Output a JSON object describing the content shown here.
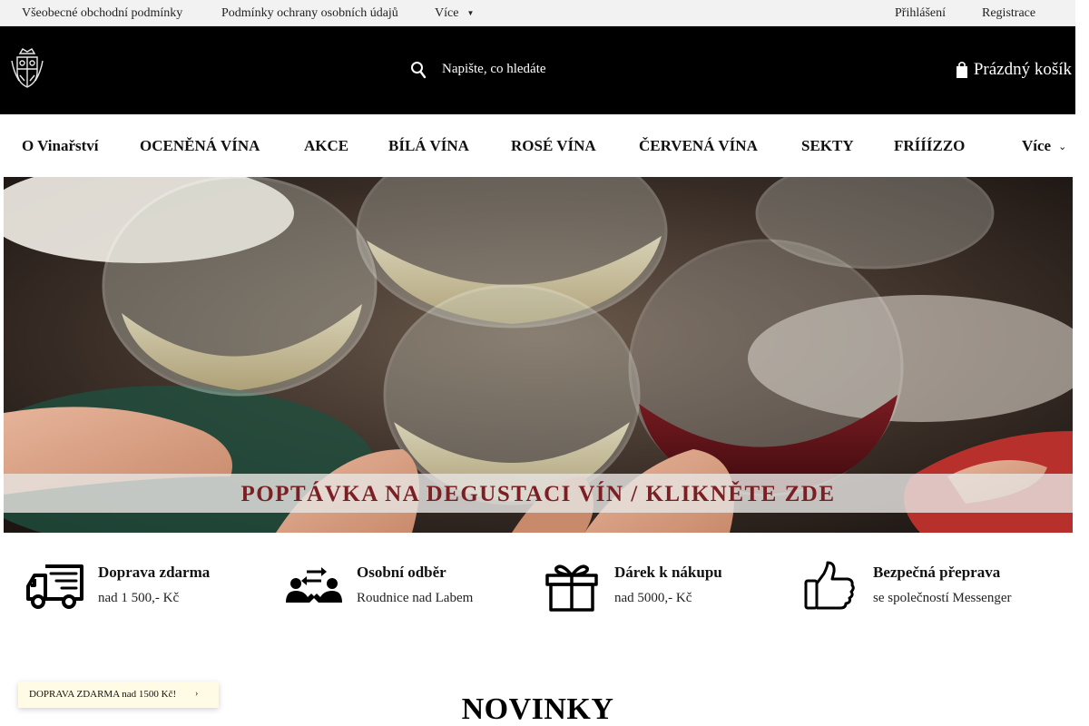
{
  "topbar": {
    "links": [
      "Všeobecné obchodní podmínky",
      "Podmínky ochrany osobních údajů"
    ],
    "more_label": "Více",
    "login": "Přihlášení",
    "register": "Registrace"
  },
  "header": {
    "search_placeholder": "Napište, co hledáte",
    "cart_label": "Prázdný košík"
  },
  "nav": {
    "items": [
      "O Vinařství",
      "OCENĚNÁ VÍNA",
      "AKCE",
      "BÍLÁ VÍNA",
      "ROSÉ VÍNA",
      "ČERVENÁ VÍNA",
      "SEKTY",
      "FRÍÍÍZZO"
    ],
    "more_label": "Více"
  },
  "hero": {
    "banner_text": "POPTÁVKA NA DEGUSTACI VÍN  / KLIKNĚTE ZDE"
  },
  "benefits": [
    {
      "icon": "delivery-truck-icon",
      "title": "Doprava zdarma",
      "subtitle": "nad 1 500,- Kč"
    },
    {
      "icon": "personal-pickup-icon",
      "title": "Osobní odběr",
      "subtitle": "Roudnice nad Labem"
    },
    {
      "icon": "gift-icon",
      "title": "Dárek k nákupu",
      "subtitle": "nad 5000,- Kč"
    },
    {
      "icon": "thumbs-up-icon",
      "title": "Bezpečná přeprava",
      "subtitle": "se společností Messenger"
    }
  ],
  "promo_pill": "DOPRAVA ZDARMA nad 1500 Kč!",
  "section_title": "NOVINKY",
  "colors": {
    "header_bg": "#000000",
    "topbar_bg": "#f2f2f2",
    "banner_text": "#7a1f23",
    "pill_bg": "#fffbe4"
  }
}
